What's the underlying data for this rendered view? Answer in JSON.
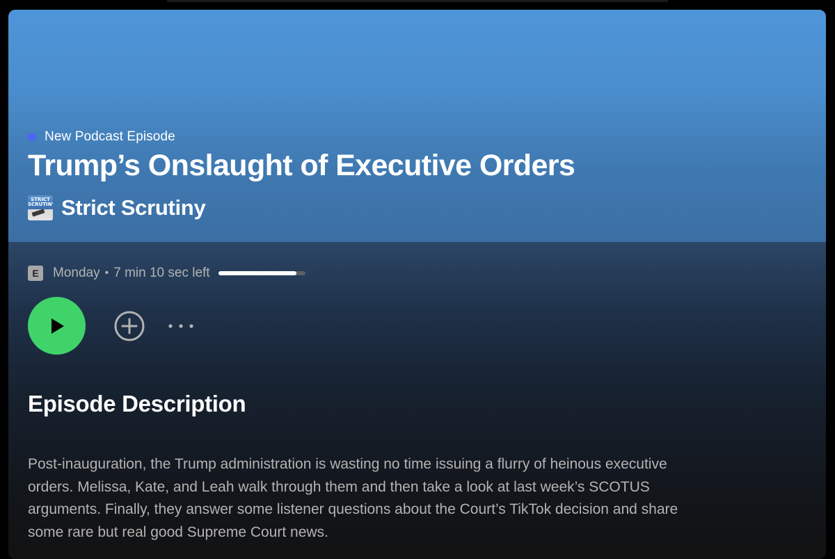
{
  "episode": {
    "badge_label": "New Podcast Episode",
    "title": "Trump’s Onslaught of Executive Orders",
    "show_name": "Strict Scrutiny",
    "show_art_line1": "STRICT",
    "show_art_line2": "SCRUTINY",
    "explicit_badge": "E",
    "date": "Monday",
    "separator": "•",
    "time_left": "7 min 10 sec left",
    "progress_fraction": 0.9
  },
  "controls": {
    "play_icon": "play-icon",
    "add_icon": "add-circle-icon",
    "more_icon": "more-horizontal-icon"
  },
  "description": {
    "heading": "Episode Description",
    "body": "Post-inauguration, the Trump administration is wasting no time issuing a flurry of heinous executive orders. Melissa, Kate, and Leah walk through them and then take a look at last week’s SCOTUS arguments. Finally, they answer some listener questions about the Court’s TikTok decision and share some rare but real good Supreme Court news."
  },
  "colors": {
    "hero_blue": "#4e95d9",
    "accent_dot": "#4a66f2",
    "play_green": "#3fd36a",
    "muted_text": "#b3b3b3"
  }
}
